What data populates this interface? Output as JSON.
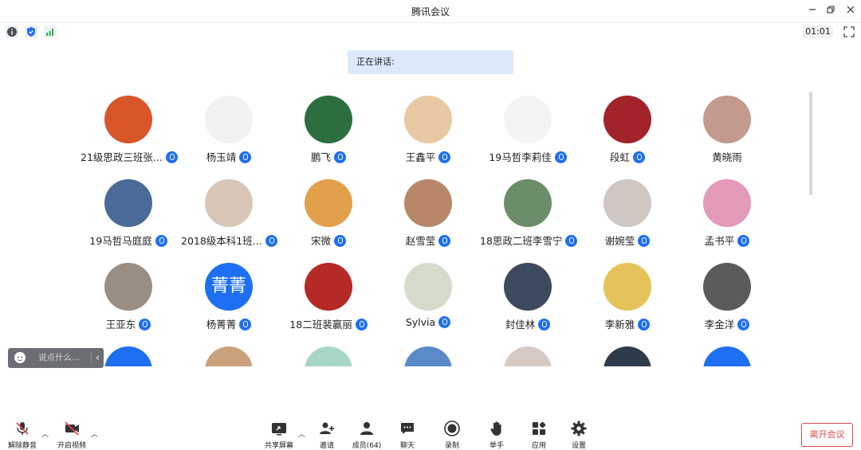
{
  "window": {
    "title": "腾讯会议"
  },
  "info_bar": {
    "timer": "01:01"
  },
  "speaking": {
    "label": "正在讲话:"
  },
  "participants": [
    {
      "name": "21级思政三班张...",
      "mic": true,
      "avatar_color": "#d9562b"
    },
    {
      "name": "杨玉靖",
      "mic": true,
      "avatar_color": "#f2f2f2"
    },
    {
      "name": "鹏飞",
      "mic": true,
      "avatar_color": "#2c6e3f"
    },
    {
      "name": "王鑫平",
      "mic": true,
      "avatar_color": "#e8c9a4"
    },
    {
      "name": "19马哲李莉佳",
      "mic": true,
      "avatar_color": "#f4f4f4"
    },
    {
      "name": "段虹",
      "mic": true,
      "avatar_color": "#a3232b"
    },
    {
      "name": "黄晓雨",
      "mic": false,
      "avatar_color": "#c49a8e"
    },
    {
      "name": "19马哲马庭庭",
      "mic": true,
      "avatar_color": "#4a6b97"
    },
    {
      "name": "2018级本科1班...",
      "mic": true,
      "avatar_color": "#d8c6b8"
    },
    {
      "name": "宋微",
      "mic": true,
      "avatar_color": "#e3a04a"
    },
    {
      "name": "赵雪莹",
      "mic": true,
      "avatar_color": "#b88768"
    },
    {
      "name": "18思政二班李雪宁",
      "mic": true,
      "avatar_color": "#6c8d6a"
    },
    {
      "name": "谢婉莹",
      "mic": true,
      "avatar_color": "#cfc7c2"
    },
    {
      "name": "孟书平",
      "mic": true,
      "avatar_color": "#e39ab8"
    },
    {
      "name": "王亚东",
      "mic": true,
      "avatar_color": "#9a8d84"
    },
    {
      "name": "杨菁菁",
      "mic": true,
      "avatar_color": "#1e6ff1",
      "avatar_text": "菁菁"
    },
    {
      "name": "18二班裴赢丽",
      "mic": true,
      "avatar_color": "#b52a26"
    },
    {
      "name": "Sylvia",
      "mic": true,
      "avatar_color": "#d6dccb"
    },
    {
      "name": "封佳林",
      "mic": true,
      "avatar_color": "#3d4a5e"
    },
    {
      "name": "李新雅",
      "mic": true,
      "avatar_color": "#e6c25a"
    },
    {
      "name": "李金洋",
      "mic": true,
      "avatar_color": "#5d5a5c"
    },
    {
      "name": "",
      "mic": false,
      "avatar_color": "#1e6ff1"
    },
    {
      "name": "",
      "mic": false,
      "avatar_color": "#c9a27b"
    },
    {
      "name": "",
      "mic": false,
      "avatar_color": "#a8d6c5"
    },
    {
      "name": "",
      "mic": false,
      "avatar_color": "#5b8ac9"
    },
    {
      "name": "",
      "mic": false,
      "avatar_color": "#d7c9c4"
    },
    {
      "name": "",
      "mic": false,
      "avatar_color": "#2e3b4a"
    },
    {
      "name": "",
      "mic": false,
      "avatar_color": "#1e6ff1"
    }
  ],
  "chat": {
    "placeholder": "说点什么..."
  },
  "toolbar": {
    "unmute": "解除静音",
    "start_video": "开启视频",
    "share_screen": "共享屏幕",
    "invite": "邀请",
    "members": "成员(64)",
    "chat": "聊天",
    "record": "录制",
    "raise_hand": "举手",
    "apps": "应用",
    "settings": "设置",
    "leave": "离开会议"
  },
  "colors": {
    "accent": "#1e6ff1",
    "danger": "#e64545",
    "speaking_bg": "#dce9fb"
  }
}
